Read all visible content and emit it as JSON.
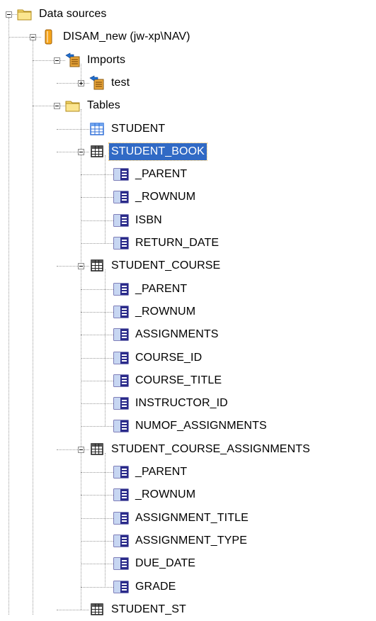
{
  "tree": {
    "nodes": [
      {
        "label": "Data sources",
        "icon": "folder-icon",
        "depth": 0,
        "expander": "minus"
      },
      {
        "label": "DISAM_new (jw-xp\\NAV)",
        "icon": "database-icon",
        "depth": 1,
        "expander": "minus"
      },
      {
        "label": "Imports",
        "icon": "imports-icon",
        "depth": 2,
        "expander": "minus"
      },
      {
        "label": "test",
        "icon": "imports-icon",
        "depth": 3,
        "expander": "plus"
      },
      {
        "label": "Tables",
        "icon": "folder-icon",
        "depth": 2,
        "expander": "minus"
      },
      {
        "label": "STUDENT",
        "icon": "table-icon",
        "depth": 3,
        "expander": "none"
      },
      {
        "label": "STUDENT_BOOK",
        "icon": "subtable-icon",
        "depth": 3,
        "expander": "minus",
        "selected": true
      },
      {
        "label": "_PARENT",
        "icon": "column-icon",
        "depth": 4,
        "expander": "none"
      },
      {
        "label": "_ROWNUM",
        "icon": "column-icon",
        "depth": 4,
        "expander": "none"
      },
      {
        "label": "ISBN",
        "icon": "column-icon",
        "depth": 4,
        "expander": "none"
      },
      {
        "label": "RETURN_DATE",
        "icon": "column-icon",
        "depth": 4,
        "expander": "none"
      },
      {
        "label": "STUDENT_COURSE",
        "icon": "subtable-icon",
        "depth": 3,
        "expander": "minus"
      },
      {
        "label": "_PARENT",
        "icon": "column-icon",
        "depth": 4,
        "expander": "none"
      },
      {
        "label": "_ROWNUM",
        "icon": "column-icon",
        "depth": 4,
        "expander": "none"
      },
      {
        "label": "ASSIGNMENTS",
        "icon": "column-icon",
        "depth": 4,
        "expander": "none"
      },
      {
        "label": "COURSE_ID",
        "icon": "column-icon",
        "depth": 4,
        "expander": "none"
      },
      {
        "label": "COURSE_TITLE",
        "icon": "column-icon",
        "depth": 4,
        "expander": "none"
      },
      {
        "label": "INSTRUCTOR_ID",
        "icon": "column-icon",
        "depth": 4,
        "expander": "none"
      },
      {
        "label": "NUMOF_ASSIGNMENTS",
        "icon": "column-icon",
        "depth": 4,
        "expander": "none"
      },
      {
        "label": "STUDENT_COURSE_ASSIGNMENTS",
        "icon": "subtable-icon",
        "depth": 3,
        "expander": "minus"
      },
      {
        "label": "_PARENT",
        "icon": "column-icon",
        "depth": 4,
        "expander": "none"
      },
      {
        "label": "_ROWNUM",
        "icon": "column-icon",
        "depth": 4,
        "expander": "none"
      },
      {
        "label": "ASSIGNMENT_TITLE",
        "icon": "column-icon",
        "depth": 4,
        "expander": "none"
      },
      {
        "label": "ASSIGNMENT_TYPE",
        "icon": "column-icon",
        "depth": 4,
        "expander": "none"
      },
      {
        "label": "DUE_DATE",
        "icon": "column-icon",
        "depth": 4,
        "expander": "none"
      },
      {
        "label": "GRADE",
        "icon": "column-icon",
        "depth": 4,
        "expander": "none"
      },
      {
        "label": "STUDENT_ST",
        "icon": "subtable-icon",
        "depth": 3,
        "expander": "none"
      }
    ]
  },
  "colors": {
    "selection": "#316ac5",
    "folder": "#f4d66b",
    "table_blue": "#2f6fd8",
    "column_navy": "#2a2a8a"
  }
}
